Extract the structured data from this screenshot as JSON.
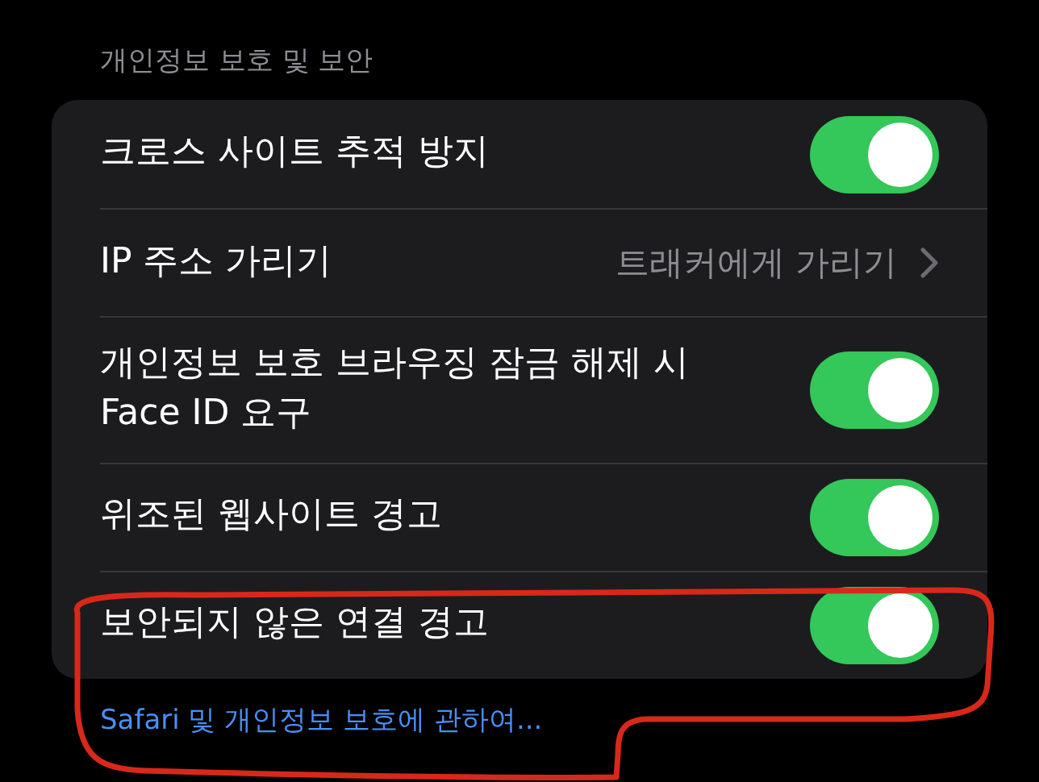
{
  "section_header": "개인정보 보호 및 보안",
  "rows": [
    {
      "kind": "toggle",
      "label": "크로스 사이트 추적 방지",
      "on": true
    },
    {
      "kind": "disclosure",
      "label": "IP 주소 가리기",
      "value": "트래커에게 가리기"
    },
    {
      "kind": "toggle",
      "label": "개인정보 보호 브라우징 잠금 해제 시 Face ID 요구",
      "on": true
    },
    {
      "kind": "toggle",
      "label": "위조된 웹사이트 경고",
      "on": true
    },
    {
      "kind": "toggle",
      "label": "보안되지 않은 연결 경고",
      "on": true
    }
  ],
  "footer_link": "Safari 및 개인정보 보호에 관하여..."
}
